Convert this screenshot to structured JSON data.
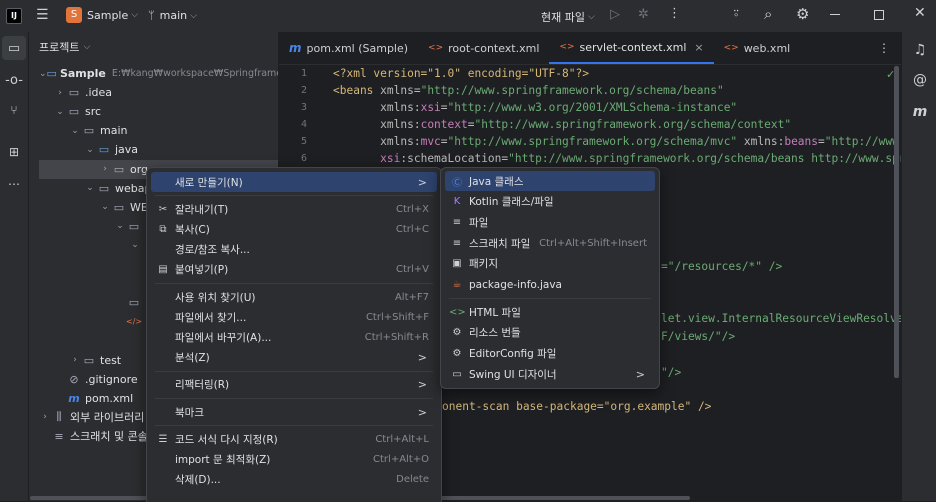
{
  "titlebar": {
    "project_badge": "S",
    "project_name": "Sample",
    "branch": "main",
    "run_config": "현재 파일"
  },
  "project_panel": {
    "title": "프로젝트",
    "tree": [
      {
        "label": "Sample",
        "path": "E:₩kang₩workspace₩Springframework",
        "indent": 0,
        "chev": "v",
        "icon": "module-folder-icon"
      },
      {
        "label": ".idea",
        "indent": 1,
        "chev": ">",
        "icon": "folder-icon"
      },
      {
        "label": "src",
        "indent": 1,
        "chev": "v",
        "icon": "folder-icon"
      },
      {
        "label": "main",
        "indent": 2,
        "chev": "v",
        "icon": "folder-icon"
      },
      {
        "label": "java",
        "indent": 3,
        "chev": "v",
        "icon": "source-folder-icon"
      },
      {
        "label": "org",
        "indent": 4,
        "chev": ">",
        "icon": "package-icon",
        "selected": true
      },
      {
        "label": "webap",
        "indent": 3,
        "chev": "v",
        "icon": "folder-icon"
      },
      {
        "label": "WE",
        "indent": 4,
        "chev": "v",
        "icon": "folder-icon"
      },
      {
        "label": "",
        "indent": 5,
        "chev": "v",
        "icon": "folder-icon"
      },
      {
        "label": "",
        "indent": 6,
        "chev": "v",
        "icon": ""
      },
      {
        "label": "",
        "indent": 6,
        "chev": "",
        "icon": ""
      },
      {
        "label": "",
        "indent": 6,
        "chev": "",
        "icon": ""
      },
      {
        "label": "",
        "indent": 5,
        "chev": "",
        "icon": "folder-icon"
      },
      {
        "label": "",
        "indent": 5,
        "chev": "",
        "icon": "xml-file-icon"
      },
      {
        "label": "",
        "indent": 2,
        "chev": "",
        "icon": ""
      },
      {
        "label": "test",
        "indent": 2,
        "chev": ">",
        "icon": "folder-icon"
      },
      {
        "label": ".gitignore",
        "indent": 1,
        "chev": "",
        "icon": "gitignore-icon"
      },
      {
        "label": "pom.xml",
        "indent": 1,
        "chev": "",
        "icon": "maven-icon"
      },
      {
        "label": "외부 라이브러리",
        "indent": 0,
        "chev": ">",
        "icon": "library-icon"
      },
      {
        "label": "스크래치 및 콘솔",
        "indent": 0,
        "chev": "",
        "icon": "scratch-icon"
      }
    ]
  },
  "tabs": [
    {
      "label": "pom.xml (Sample)",
      "icon": "m",
      "icon_color": "#4a86e8"
    },
    {
      "label": "root-context.xml",
      "icon": "<>",
      "icon_color": "#e8754a"
    },
    {
      "label": "servlet-context.xml",
      "icon": "<>",
      "icon_color": "#e8754a",
      "active": true,
      "close": "×"
    },
    {
      "label": "web.xml",
      "icon": "<>",
      "icon_color": "#e8754a"
    }
  ],
  "line_numbers": [
    "1",
    "2",
    "3",
    "4",
    "5",
    "6"
  ],
  "code_lines": [
    [
      {
        "t": "<?xml version=\"1.0\" encoding=\"UTF-8\"?>",
        "c": "tag"
      }
    ],
    [
      {
        "t": "<beans ",
        "c": "tag"
      },
      {
        "t": "xmlns=",
        "c": "attr"
      },
      {
        "t": "\"http://www.springframework.org/schema/beans\"",
        "c": "str"
      }
    ],
    [
      {
        "t": "       "
      },
      {
        "t": "xmlns:",
        "c": "attr"
      },
      {
        "t": "xsi",
        "c": "ns"
      },
      {
        "t": "=",
        "c": "attr"
      },
      {
        "t": "\"http://www.w3.org/2001/XMLSchema-instance\"",
        "c": "str"
      }
    ],
    [
      {
        "t": "       "
      },
      {
        "t": "xmlns:",
        "c": "attr"
      },
      {
        "t": "context",
        "c": "ns"
      },
      {
        "t": "=",
        "c": "attr"
      },
      {
        "t": "\"http://www.springframework.org/schema/context\"",
        "c": "str"
      }
    ],
    [
      {
        "t": "       "
      },
      {
        "t": "xmlns:",
        "c": "attr"
      },
      {
        "t": "mvc",
        "c": "ns"
      },
      {
        "t": "=",
        "c": "attr"
      },
      {
        "t": "\"http://www.springframework.org/schema/mvc\"",
        "c": "str"
      },
      {
        "t": " xmlns:",
        "c": "attr"
      },
      {
        "t": "beans",
        "c": "ns"
      },
      {
        "t": "=",
        "c": "attr"
      },
      {
        "t": "\"http://www.sprin",
        "c": "str"
      }
    ],
    [
      {
        "t": "       "
      },
      {
        "t": "xsi",
        "c": "ns"
      },
      {
        "t": ":schemaLocation=",
        "c": "attr"
      },
      {
        "t": "\"http://www.springframework.org/schema/beans http://www.springfr",
        "c": "str"
      }
    ]
  ],
  "code_fragments": [
    {
      "t": "=\"/resources/*\" />"
    },
    {
      "t": "let.view.InternalResourceViewResolver\">"
    },
    {
      "t": "F/views/\"/>"
    },
    {
      "t": "\"/>"
    },
    {
      "t": "onent-scan base-package=\"org.example\" />"
    }
  ],
  "context_menu": [
    {
      "label": "새로 만들기(N)",
      "arrow": ">",
      "hl": true
    },
    {
      "sep": true
    },
    {
      "label": "잘라내기(T)",
      "shortcut": "Ctrl+X",
      "icon": "✂"
    },
    {
      "label": "복사(C)",
      "shortcut": "Ctrl+C",
      "icon": "⧉"
    },
    {
      "label": "경로/참조 복사..."
    },
    {
      "label": "붙여넣기(P)",
      "shortcut": "Ctrl+V",
      "icon": "▤"
    },
    {
      "sep": true
    },
    {
      "label": "사용 위치 찾기(U)",
      "shortcut": "Alt+F7"
    },
    {
      "label": "파일에서 찾기...",
      "shortcut": "Ctrl+Shift+F"
    },
    {
      "label": "파일에서 바꾸기(A)...",
      "shortcut": "Ctrl+Shift+R"
    },
    {
      "label": "분석(Z)",
      "arrow": ">"
    },
    {
      "sep": true
    },
    {
      "label": "리팩터링(R)",
      "arrow": ">"
    },
    {
      "sep": true
    },
    {
      "label": "북마크",
      "arrow": ">"
    },
    {
      "sep": true
    },
    {
      "label": "코드 서식 다시 지정(R)",
      "shortcut": "Ctrl+Alt+L",
      "icon": "☰"
    },
    {
      "label": "import 문 최적화(Z)",
      "shortcut": "Ctrl+Alt+O"
    },
    {
      "label": "삭제(D)...",
      "shortcut": "Delete"
    }
  ],
  "submenu": [
    {
      "label": "Java 클래스",
      "icon": "Ⓒ",
      "icon_color": "#4a86e8",
      "hl": true
    },
    {
      "label": "Kotlin 클래스/파일",
      "icon": "K",
      "icon_color": "#a97bff"
    },
    {
      "label": "파일",
      "icon": "≡",
      "icon_color": "#ced0d6"
    },
    {
      "label": "스크래치 파일",
      "shortcut": "Ctrl+Alt+Shift+Insert",
      "icon": "≡",
      "icon_color": "#ced0d6"
    },
    {
      "label": "패키지",
      "icon": "▣",
      "icon_color": "#ced0d6"
    },
    {
      "label": "package-info.java",
      "icon": "☕",
      "icon_color": "#e8754a"
    },
    {
      "sep": true
    },
    {
      "label": "HTML 파일",
      "icon": "<>",
      "icon_color": "#6aab73"
    },
    {
      "label": "리소스 번들",
      "icon": "⚙",
      "icon_color": "#ced0d6"
    },
    {
      "label": "EditorConfig 파일",
      "icon": "⚙",
      "icon_color": "#ced0d6"
    },
    {
      "label": "Swing UI 디자이너",
      "icon": "▭",
      "icon_color": "#ced0d6",
      "arrow": ">"
    }
  ]
}
